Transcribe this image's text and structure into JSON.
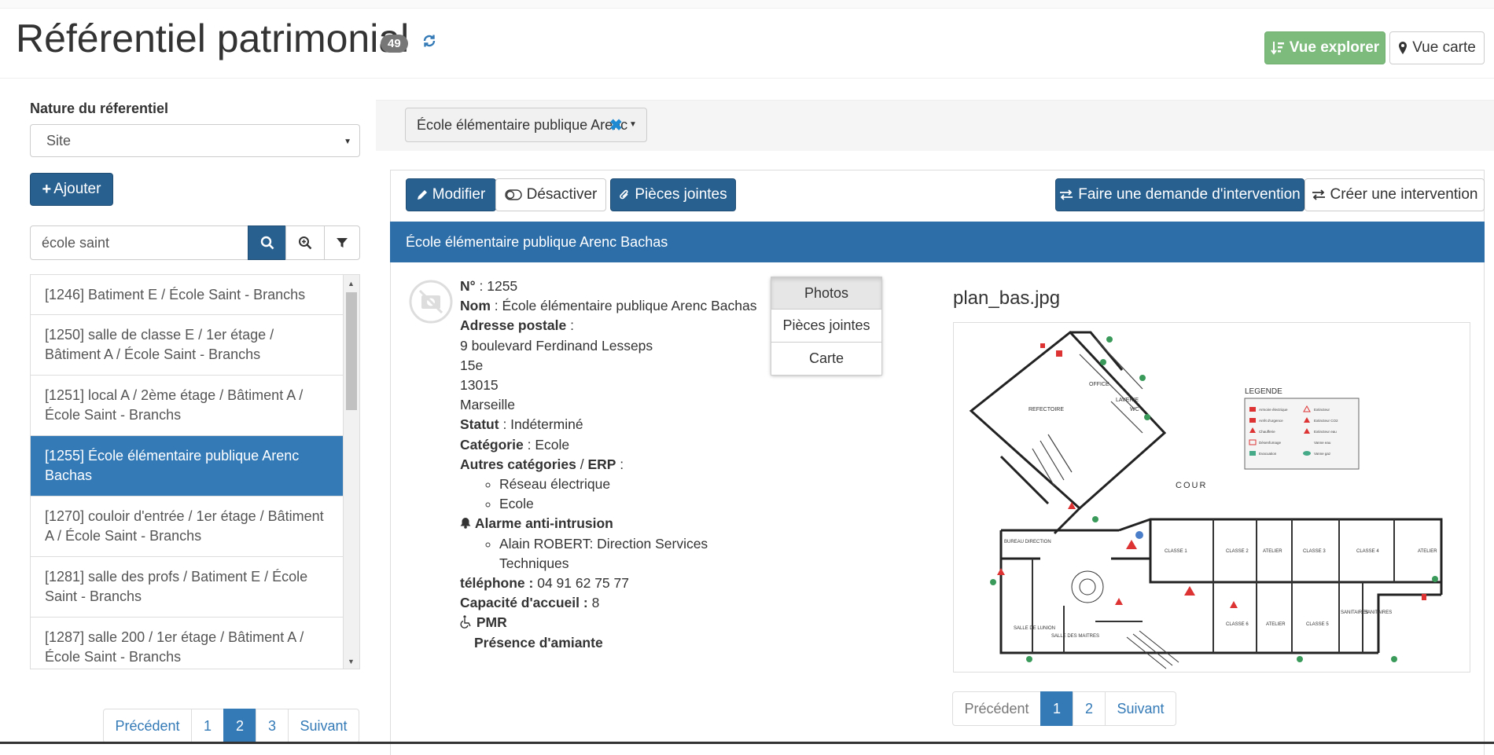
{
  "header": {
    "title": "Référentiel patrimonial",
    "count": "49",
    "btn_explorer": "Vue explorer",
    "btn_carte": "Vue carte"
  },
  "sidebar": {
    "nature_label": "Nature du réferentiel",
    "nature_value": "Site",
    "add_label": "Ajouter",
    "search_value": "école saint",
    "items": [
      {
        "label": "[1246] Batiment E / École Saint - Branchs"
      },
      {
        "label": "[1250] salle de classe E / 1er étage / Bâtiment A / École Saint - Branchs"
      },
      {
        "label": "[1251] local A / 2ème étage / Bâtiment A / École Saint - Branchs"
      },
      {
        "label": "[1255] École élémentaire publique Arenc Bachas"
      },
      {
        "label": "[1270] couloir d'entrée / 1er étage / Bâtiment A / École Saint - Branchs"
      },
      {
        "label": "[1281] salle des profs / Batiment E / École Saint - Branchs"
      },
      {
        "label": "[1287] salle 200 / 1er étage / Bâtiment A / École Saint - Branchs"
      }
    ],
    "pagination": {
      "prev": "Précédent",
      "pages": [
        "1",
        "2",
        "3"
      ],
      "active": "2",
      "next": "Suivant"
    }
  },
  "main": {
    "filter_value": "École élémentaire publique Arenc",
    "toolbar": {
      "modifier": "Modifier",
      "desactiver": "Désactiver",
      "pieces_jointes": "Pièces jointes",
      "demande_intervention": "Faire une demande d'intervention",
      "creer_intervention": "Créer une intervention"
    },
    "panel_title": "École élémentaire publique Arenc Bachas",
    "details": {
      "numero_label": "N°",
      "numero": "1255",
      "nom_label": "Nom",
      "nom": "École élémentaire publique Arenc Bachas",
      "adresse_label": "Adresse postale",
      "adresse_lines": [
        "9 boulevard Ferdinand Lesseps",
        "15e",
        "13015",
        "Marseille"
      ],
      "statut_label": "Statut",
      "statut": "Indéterminé",
      "categorie_label": "Catégorie",
      "categorie": "Ecole",
      "autres_label": "Autres catégories",
      "erp_label": "ERP",
      "autres": [
        "Réseau électrique",
        "Ecole"
      ],
      "alarme_label": "Alarme anti-intrusion",
      "alarme_contacts": [
        "Alain ROBERT: Direction Services Techniques"
      ],
      "telephone_label": "téléphone :",
      "telephone": "04 91 62 75 77",
      "capacite_label": "Capacité d'accueil :",
      "capacite": "8",
      "pmr_label": "PMR",
      "amiante_label": "Présence d'amiante"
    },
    "tabs": [
      "Photos",
      "Pièces jointes",
      "Carte"
    ],
    "active_tab": "Photos",
    "plan": {
      "filename": "plan_bas.jpg",
      "legend_title": "LEGENDE",
      "cour_label": "COUR",
      "refectoire_label": "REFECTOIRE",
      "office_label": "OFFICE",
      "laverie_label": "LAVERIE",
      "wc_label": "WC",
      "bureau_label": "BUREAU DIRECTION",
      "salle_union_label": "SALLE DE LUNION",
      "salle_maitres_label": "SALLE DES MAITRES",
      "rooms_top": [
        "CLASSE 1",
        "CLASSE 2",
        "ATELIER",
        "CLASSE 3",
        "CLASSE 4",
        "ATELIER"
      ],
      "rooms_bottom": [
        "CLASSE 6",
        "ATELIER",
        "CLASSE 5",
        "SANITAIRES",
        "SANITAIRES"
      ],
      "legend_items": [
        "Armoire électrique",
        "Arrêt d'urgence",
        "Chaufferie",
        "Désenfumage",
        "Evacuation",
        "Extincteur",
        "Extincteur CO2",
        "Extincteur eau",
        "Vanne eau",
        "Vanne gaz"
      ]
    },
    "plan_pagination": {
      "prev": "Précédent",
      "pages": [
        "1",
        "2"
      ],
      "active": "1",
      "next": "Suivant"
    }
  },
  "colors": {
    "primary": "#337ab7",
    "primary_dark": "#286090",
    "success": "#7dbb7d",
    "panel_head": "#2d6ea8"
  }
}
